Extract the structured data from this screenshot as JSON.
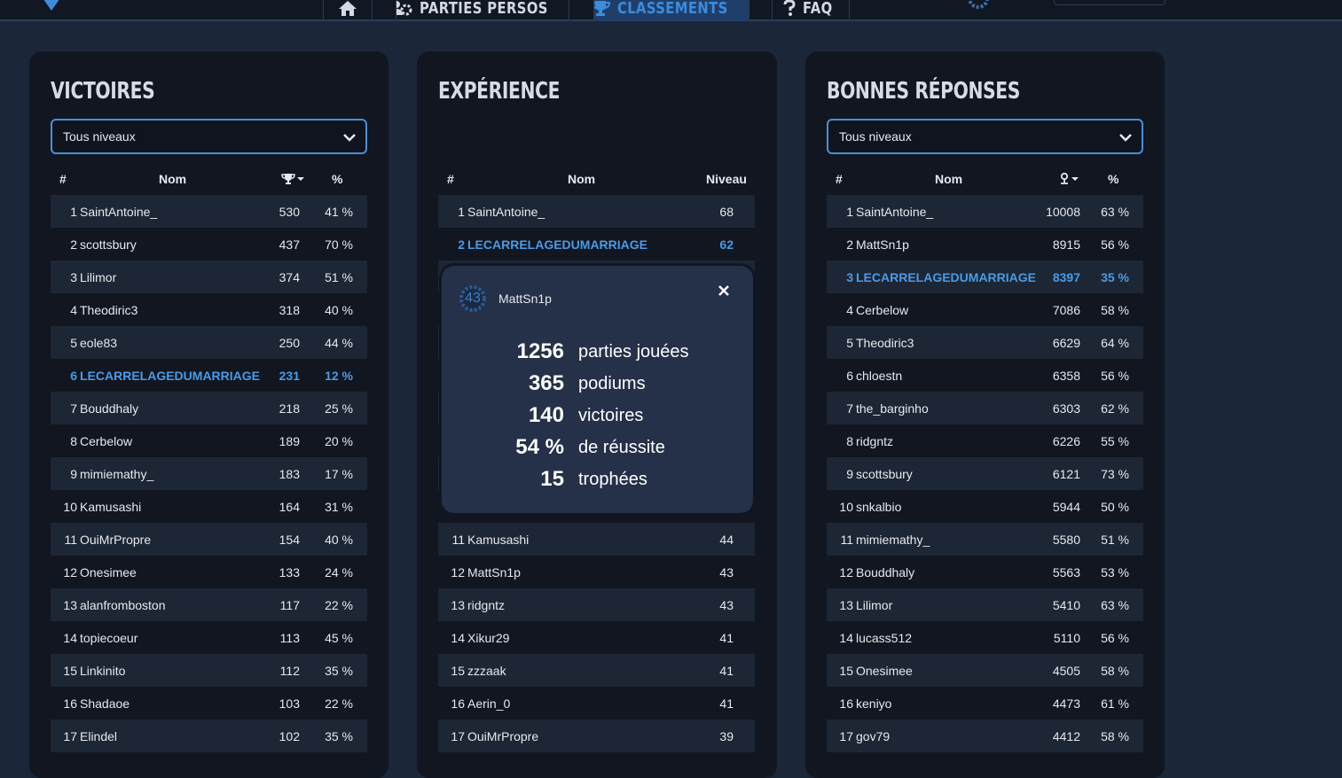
{
  "nav": {
    "parties_label": "PARTIES PERSOS",
    "classements_label": "CLASSEMENTS",
    "faq_label": "FAQ"
  },
  "colors": {
    "accent": "#4a9be6",
    "panel": "#111621",
    "row_alt": "#1d2634",
    "popup": "#243148"
  },
  "victoires": {
    "title": "VICTOIRES",
    "filter_value": "Tous niveaux",
    "headers": {
      "rank": "#",
      "name": "Nom",
      "pct": "%"
    },
    "value_icon": "trophy-icon",
    "rows": [
      {
        "rank": "1",
        "name": "SaintAntoine_",
        "value": "530",
        "pct": "41 %"
      },
      {
        "rank": "2",
        "name": "scottsbury",
        "value": "437",
        "pct": "70 %"
      },
      {
        "rank": "3",
        "name": "Lilimor",
        "value": "374",
        "pct": "51 %"
      },
      {
        "rank": "4",
        "name": "Theodiric3",
        "value": "318",
        "pct": "40 %"
      },
      {
        "rank": "5",
        "name": "eole83",
        "value": "250",
        "pct": "44 %"
      },
      {
        "rank": "6",
        "name": "LECARRELAGEDUMARRIAGE",
        "value": "231",
        "pct": "12 %",
        "me": true
      },
      {
        "rank": "7",
        "name": "Bouddhaly",
        "value": "218",
        "pct": "25 %"
      },
      {
        "rank": "8",
        "name": "Cerbelow",
        "value": "189",
        "pct": "20 %"
      },
      {
        "rank": "9",
        "name": "mimiemathy_",
        "value": "183",
        "pct": "17 %"
      },
      {
        "rank": "10",
        "name": "Kamusashi",
        "value": "164",
        "pct": "31 %"
      },
      {
        "rank": "11",
        "name": "OuiMrPropre",
        "value": "154",
        "pct": "40 %"
      },
      {
        "rank": "12",
        "name": "Onesimee",
        "value": "133",
        "pct": "24 %"
      },
      {
        "rank": "13",
        "name": "alanfromboston",
        "value": "117",
        "pct": "22 %"
      },
      {
        "rank": "14",
        "name": "topiecoeur",
        "value": "113",
        "pct": "45 %"
      },
      {
        "rank": "15",
        "name": "Linkinito",
        "value": "112",
        "pct": "35 %"
      },
      {
        "rank": "16",
        "name": "Shadaoe",
        "value": "103",
        "pct": "22 %"
      },
      {
        "rank": "17",
        "name": "Elindel",
        "value": "102",
        "pct": "35 %"
      }
    ]
  },
  "experience": {
    "title": "EXPÉRIENCE",
    "headers": {
      "rank": "#",
      "name": "Nom",
      "level": "Niveau"
    },
    "rows": [
      {
        "rank": "1",
        "name": "SaintAntoine_",
        "level": "68"
      },
      {
        "rank": "2",
        "name": "LECARRELAGEDUMARRIAGE",
        "level": "62",
        "me": true
      },
      {
        "rank": "11",
        "name": "Kamusashi",
        "level": "44"
      },
      {
        "rank": "12",
        "name": "MattSn1p",
        "level": "43"
      },
      {
        "rank": "13",
        "name": "ridgntz",
        "level": "43"
      },
      {
        "rank": "14",
        "name": "Xikur29",
        "level": "41"
      },
      {
        "rank": "15",
        "name": "zzzaak",
        "level": "41"
      },
      {
        "rank": "16",
        "name": "Aerin_0",
        "level": "41"
      },
      {
        "rank": "17",
        "name": "OuiMrPropre",
        "level": "39"
      }
    ]
  },
  "popup": {
    "level": "43",
    "username": "MattSn1p",
    "stats": [
      {
        "value": "1256",
        "label": "parties jouées"
      },
      {
        "value": "365",
        "label": "podiums"
      },
      {
        "value": "140",
        "label": "victoires"
      },
      {
        "value": "54 %",
        "label": "de réussite"
      },
      {
        "value": "15",
        "label": "trophées"
      }
    ]
  },
  "bonnes": {
    "title": "BONNES RÉPONSES",
    "filter_value": "Tous niveaux",
    "headers": {
      "rank": "#",
      "name": "Nom",
      "pct": "%"
    },
    "value_icon": "user-answer-icon",
    "rows": [
      {
        "rank": "1",
        "name": "SaintAntoine_",
        "value": "10008",
        "pct": "63 %"
      },
      {
        "rank": "2",
        "name": "MattSn1p",
        "value": "8915",
        "pct": "56 %"
      },
      {
        "rank": "3",
        "name": "LECARRELAGEDUMARRIAGE",
        "value": "8397",
        "pct": "35 %",
        "me": true
      },
      {
        "rank": "4",
        "name": "Cerbelow",
        "value": "7086",
        "pct": "58 %"
      },
      {
        "rank": "5",
        "name": "Theodiric3",
        "value": "6629",
        "pct": "64 %"
      },
      {
        "rank": "6",
        "name": "chloestn",
        "value": "6358",
        "pct": "56 %"
      },
      {
        "rank": "7",
        "name": "the_barginho",
        "value": "6303",
        "pct": "62 %"
      },
      {
        "rank": "8",
        "name": "ridgntz",
        "value": "6226",
        "pct": "55 %"
      },
      {
        "rank": "9",
        "name": "scottsbury",
        "value": "6121",
        "pct": "73 %"
      },
      {
        "rank": "10",
        "name": "snkalbio",
        "value": "5944",
        "pct": "50 %"
      },
      {
        "rank": "11",
        "name": "mimiemathy_",
        "value": "5580",
        "pct": "51 %"
      },
      {
        "rank": "12",
        "name": "Bouddhaly",
        "value": "5563",
        "pct": "53 %"
      },
      {
        "rank": "13",
        "name": "Lilimor",
        "value": "5410",
        "pct": "63 %"
      },
      {
        "rank": "14",
        "name": "lucass512",
        "value": "5110",
        "pct": "56 %"
      },
      {
        "rank": "15",
        "name": "Onesimee",
        "value": "4505",
        "pct": "58 %"
      },
      {
        "rank": "16",
        "name": "keniyo",
        "value": "4473",
        "pct": "61 %"
      },
      {
        "rank": "17",
        "name": "gov79",
        "value": "4412",
        "pct": "58 %"
      }
    ]
  }
}
